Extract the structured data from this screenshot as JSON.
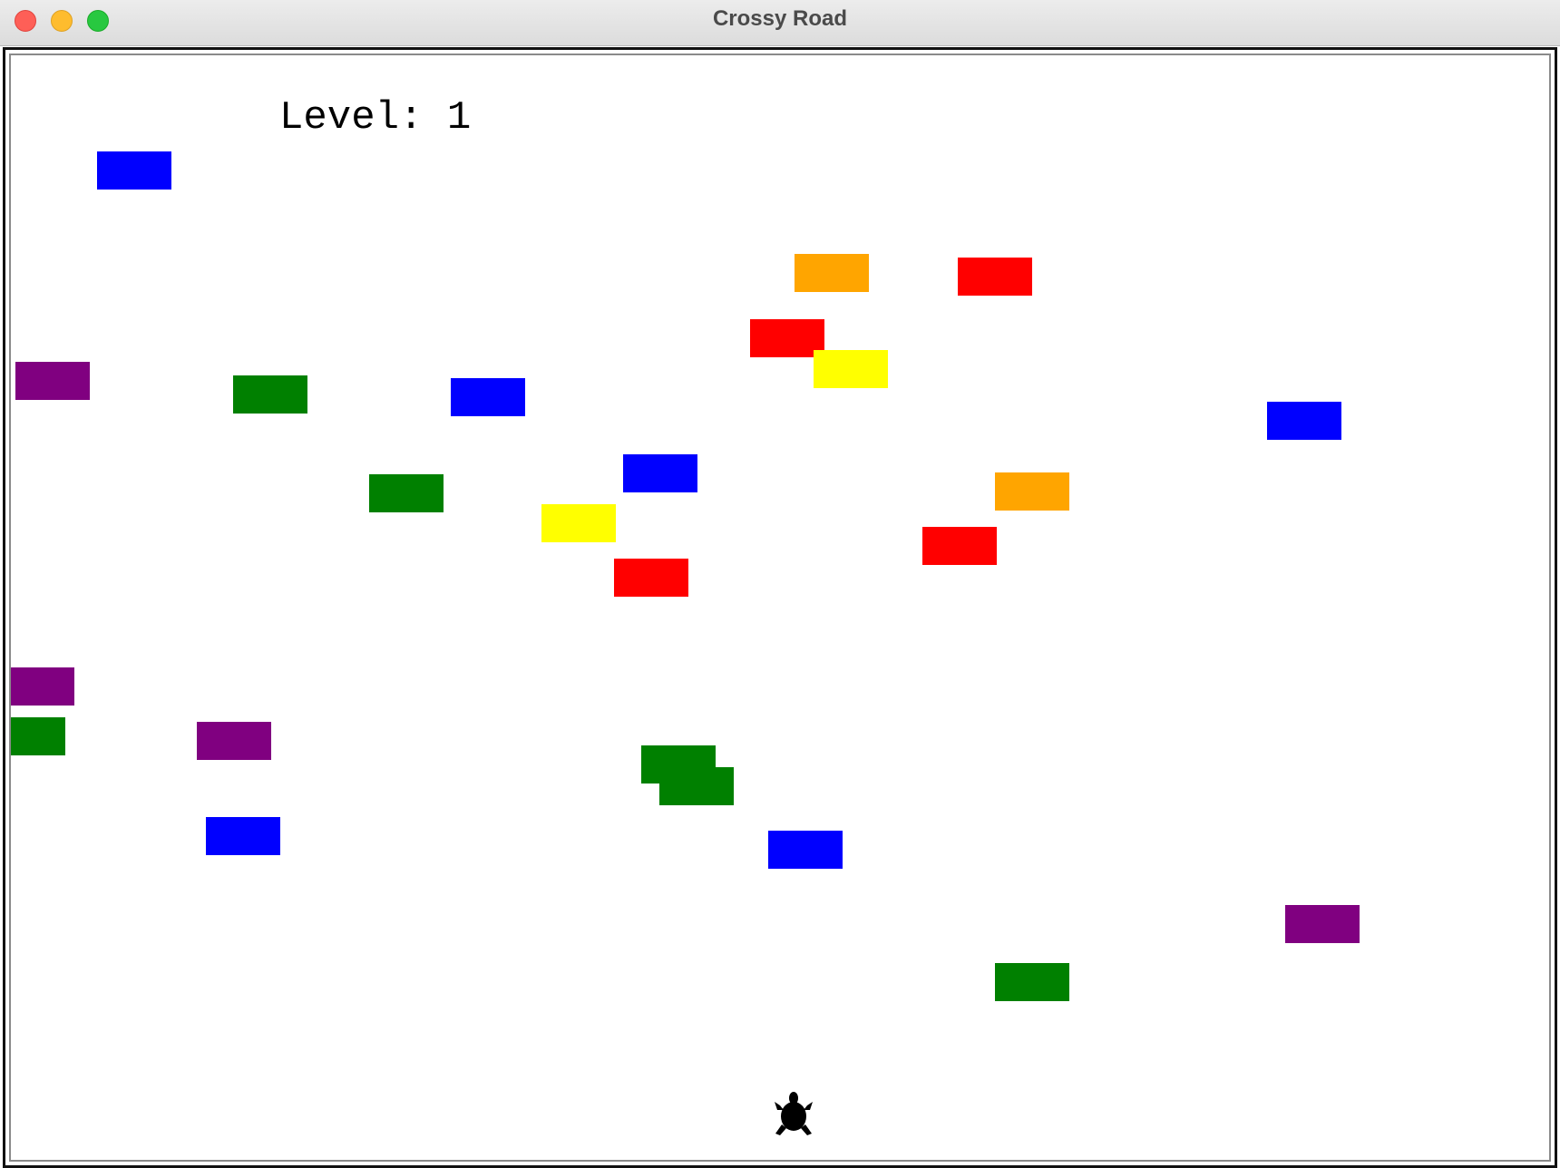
{
  "window": {
    "title": "Crossy Road"
  },
  "hud": {
    "level_text": "Level: 1",
    "level": 1
  },
  "colors": {
    "blue": "#0000ff",
    "red": "#ff0000",
    "orange": "#ffa500",
    "yellow": "#ffff00",
    "green": "#008000",
    "purple": "#800080",
    "player": "#000000",
    "background": "#ffffff"
  },
  "entities": {
    "cars": [
      "blue",
      "orange",
      "red",
      "red",
      "yellow",
      "purple",
      "green",
      "blue",
      "blue",
      "blue",
      "green",
      "orange",
      "yellow",
      "red",
      "red",
      "purple",
      "green",
      "purple",
      "green",
      "green",
      "blue",
      "blue",
      "purple",
      "green"
    ],
    "player": {
      "shape": "turtle",
      "icon": "turtle-icon"
    }
  }
}
